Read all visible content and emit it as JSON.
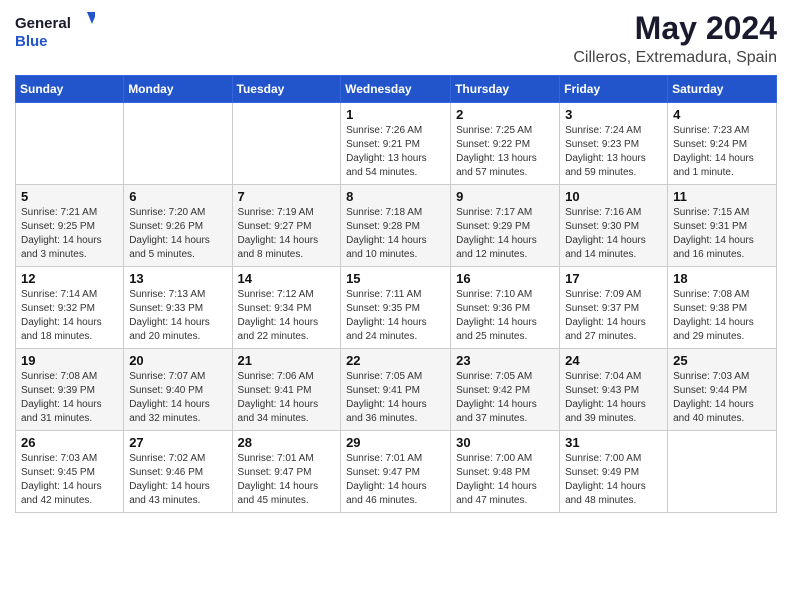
{
  "header": {
    "logo_general": "General",
    "logo_blue": "Blue",
    "main_title": "May 2024",
    "subtitle": "Cilleros, Extremadura, Spain"
  },
  "days": [
    "Sunday",
    "Monday",
    "Tuesday",
    "Wednesday",
    "Thursday",
    "Friday",
    "Saturday"
  ],
  "weeks": [
    [
      {
        "date": "",
        "info": ""
      },
      {
        "date": "",
        "info": ""
      },
      {
        "date": "",
        "info": ""
      },
      {
        "date": "1",
        "info": "Sunrise: 7:26 AM\nSunset: 9:21 PM\nDaylight: 13 hours and 54 minutes."
      },
      {
        "date": "2",
        "info": "Sunrise: 7:25 AM\nSunset: 9:22 PM\nDaylight: 13 hours and 57 minutes."
      },
      {
        "date": "3",
        "info": "Sunrise: 7:24 AM\nSunset: 9:23 PM\nDaylight: 13 hours and 59 minutes."
      },
      {
        "date": "4",
        "info": "Sunrise: 7:23 AM\nSunset: 9:24 PM\nDaylight: 14 hours and 1 minute."
      }
    ],
    [
      {
        "date": "5",
        "info": "Sunrise: 7:21 AM\nSunset: 9:25 PM\nDaylight: 14 hours and 3 minutes."
      },
      {
        "date": "6",
        "info": "Sunrise: 7:20 AM\nSunset: 9:26 PM\nDaylight: 14 hours and 5 minutes."
      },
      {
        "date": "7",
        "info": "Sunrise: 7:19 AM\nSunset: 9:27 PM\nDaylight: 14 hours and 8 minutes."
      },
      {
        "date": "8",
        "info": "Sunrise: 7:18 AM\nSunset: 9:28 PM\nDaylight: 14 hours and 10 minutes."
      },
      {
        "date": "9",
        "info": "Sunrise: 7:17 AM\nSunset: 9:29 PM\nDaylight: 14 hours and 12 minutes."
      },
      {
        "date": "10",
        "info": "Sunrise: 7:16 AM\nSunset: 9:30 PM\nDaylight: 14 hours and 14 minutes."
      },
      {
        "date": "11",
        "info": "Sunrise: 7:15 AM\nSunset: 9:31 PM\nDaylight: 14 hours and 16 minutes."
      }
    ],
    [
      {
        "date": "12",
        "info": "Sunrise: 7:14 AM\nSunset: 9:32 PM\nDaylight: 14 hours and 18 minutes."
      },
      {
        "date": "13",
        "info": "Sunrise: 7:13 AM\nSunset: 9:33 PM\nDaylight: 14 hours and 20 minutes."
      },
      {
        "date": "14",
        "info": "Sunrise: 7:12 AM\nSunset: 9:34 PM\nDaylight: 14 hours and 22 minutes."
      },
      {
        "date": "15",
        "info": "Sunrise: 7:11 AM\nSunset: 9:35 PM\nDaylight: 14 hours and 24 minutes."
      },
      {
        "date": "16",
        "info": "Sunrise: 7:10 AM\nSunset: 9:36 PM\nDaylight: 14 hours and 25 minutes."
      },
      {
        "date": "17",
        "info": "Sunrise: 7:09 AM\nSunset: 9:37 PM\nDaylight: 14 hours and 27 minutes."
      },
      {
        "date": "18",
        "info": "Sunrise: 7:08 AM\nSunset: 9:38 PM\nDaylight: 14 hours and 29 minutes."
      }
    ],
    [
      {
        "date": "19",
        "info": "Sunrise: 7:08 AM\nSunset: 9:39 PM\nDaylight: 14 hours and 31 minutes."
      },
      {
        "date": "20",
        "info": "Sunrise: 7:07 AM\nSunset: 9:40 PM\nDaylight: 14 hours and 32 minutes."
      },
      {
        "date": "21",
        "info": "Sunrise: 7:06 AM\nSunset: 9:41 PM\nDaylight: 14 hours and 34 minutes."
      },
      {
        "date": "22",
        "info": "Sunrise: 7:05 AM\nSunset: 9:41 PM\nDaylight: 14 hours and 36 minutes."
      },
      {
        "date": "23",
        "info": "Sunrise: 7:05 AM\nSunset: 9:42 PM\nDaylight: 14 hours and 37 minutes."
      },
      {
        "date": "24",
        "info": "Sunrise: 7:04 AM\nSunset: 9:43 PM\nDaylight: 14 hours and 39 minutes."
      },
      {
        "date": "25",
        "info": "Sunrise: 7:03 AM\nSunset: 9:44 PM\nDaylight: 14 hours and 40 minutes."
      }
    ],
    [
      {
        "date": "26",
        "info": "Sunrise: 7:03 AM\nSunset: 9:45 PM\nDaylight: 14 hours and 42 minutes."
      },
      {
        "date": "27",
        "info": "Sunrise: 7:02 AM\nSunset: 9:46 PM\nDaylight: 14 hours and 43 minutes."
      },
      {
        "date": "28",
        "info": "Sunrise: 7:01 AM\nSunset: 9:47 PM\nDaylight: 14 hours and 45 minutes."
      },
      {
        "date": "29",
        "info": "Sunrise: 7:01 AM\nSunset: 9:47 PM\nDaylight: 14 hours and 46 minutes."
      },
      {
        "date": "30",
        "info": "Sunrise: 7:00 AM\nSunset: 9:48 PM\nDaylight: 14 hours and 47 minutes."
      },
      {
        "date": "31",
        "info": "Sunrise: 7:00 AM\nSunset: 9:49 PM\nDaylight: 14 hours and 48 minutes."
      },
      {
        "date": "",
        "info": ""
      }
    ]
  ]
}
